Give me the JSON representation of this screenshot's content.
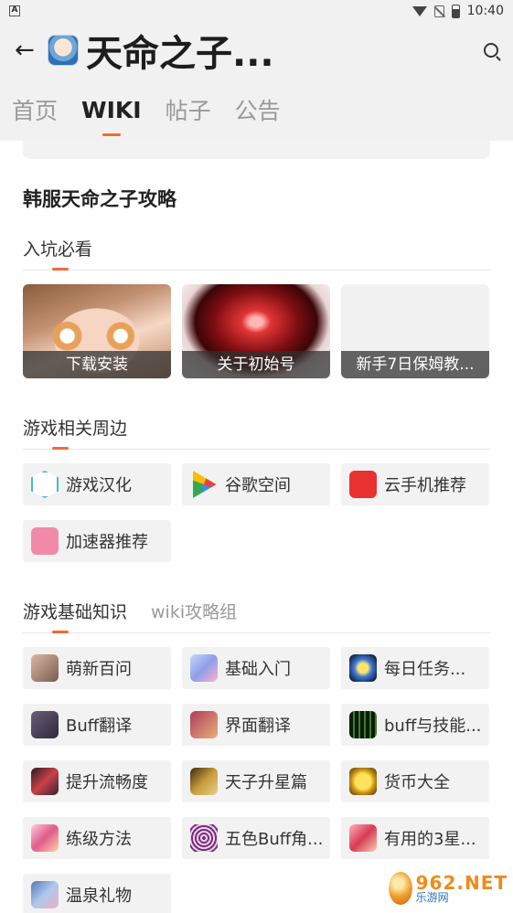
{
  "statusbar": {
    "time": "10:40"
  },
  "appbar": {
    "title": "天命之子...",
    "back_icon": "back-arrow-icon",
    "search_icon": "search-icon"
  },
  "tabs": [
    {
      "label": "首页",
      "active": false
    },
    {
      "label": "WIKI",
      "active": true
    },
    {
      "label": "帖子",
      "active": false
    },
    {
      "label": "公告",
      "active": false
    }
  ],
  "page_heading": "韩服天命之子攻略",
  "section_intro": {
    "title": "入坑必看",
    "cards": [
      {
        "label": "下载安装"
      },
      {
        "label": "关于初始号"
      },
      {
        "label": "新手7日保姆教..."
      }
    ]
  },
  "section_peripheral": {
    "title": "游戏相关周边",
    "items": [
      {
        "label": "游戏汉化",
        "icon": "hexagon-icon"
      },
      {
        "label": "谷歌空间",
        "icon": "google-play-icon"
      },
      {
        "label": "云手机推荐",
        "icon": "cloud-phone-icon"
      },
      {
        "label": "加速器推荐",
        "icon": "paper-plane-icon"
      }
    ]
  },
  "section_basics": {
    "title": "游戏基础知识",
    "subtab": "wiki攻略组",
    "items": [
      {
        "label": "萌新百问",
        "icon": "anime-avatar-icon"
      },
      {
        "label": "基础入门",
        "icon": "anime-avatar-icon"
      },
      {
        "label": "每日任务...",
        "icon": "game-art-icon"
      },
      {
        "label": "Buff翻译",
        "icon": "game-art-icon"
      },
      {
        "label": "界面翻译",
        "icon": "game-art-icon"
      },
      {
        "label": "buff与技能...",
        "icon": "game-art-icon"
      },
      {
        "label": "提升流畅度",
        "icon": "game-art-icon"
      },
      {
        "label": "天子升星篇",
        "icon": "game-art-icon"
      },
      {
        "label": "货币大全",
        "icon": "coins-icon"
      },
      {
        "label": "练级方法",
        "icon": "anime-avatar-icon"
      },
      {
        "label": "五色Buff角...",
        "icon": "pattern-icon"
      },
      {
        "label": "有用的3星...",
        "icon": "anime-avatar-icon"
      },
      {
        "label": "温泉礼物",
        "icon": "anime-avatar-icon"
      }
    ]
  },
  "watermark": {
    "main": "962.NET",
    "sub": "乐游网"
  }
}
